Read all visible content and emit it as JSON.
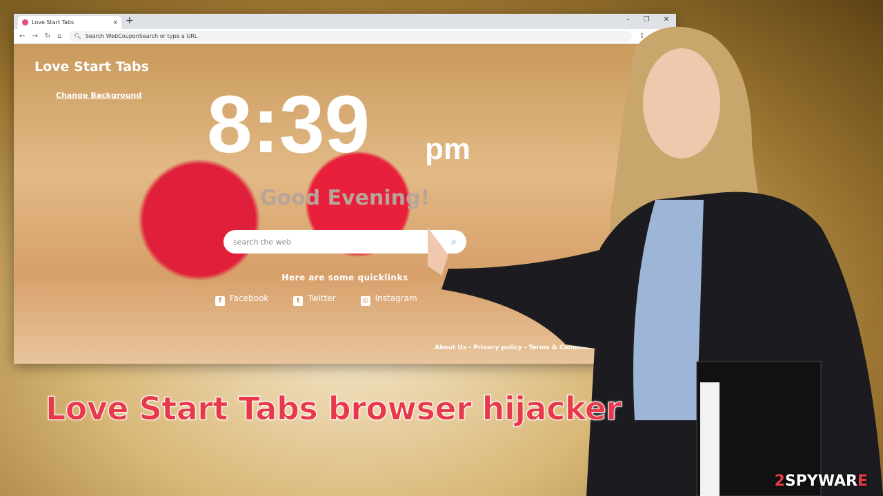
{
  "browser": {
    "tab_title": "Love Start Tabs",
    "new_tab": "+",
    "close": "x",
    "window_controls": [
      "–",
      "❐",
      "✕"
    ],
    "address_placeholder": "Search WebCouponSearch or type a URL"
  },
  "page": {
    "logo": "Love Start Tabs",
    "change_background": "Change Background",
    "time": "8:39",
    "ampm": "pm",
    "greeting": "Good Evening!",
    "search_placeholder": "search the web",
    "quicklinks_heading": "Here are some quicklinks",
    "quicklinks": [
      {
        "label": "Facebook",
        "icon": "facebook-icon"
      },
      {
        "label": "Twitter",
        "icon": "twitter-icon"
      },
      {
        "label": "Instagram",
        "icon": "instagram-icon"
      }
    ],
    "footer": "About Us - Privacy policy - Terms & Conditions - C"
  },
  "headline": "Love Start Tabs browser hijacker",
  "watermark": {
    "prefix": "2",
    "brand": "SPYWAR",
    "suffix": "E"
  },
  "colors": {
    "headline": "#e8394a",
    "search_icon": "#3a8fd6"
  }
}
